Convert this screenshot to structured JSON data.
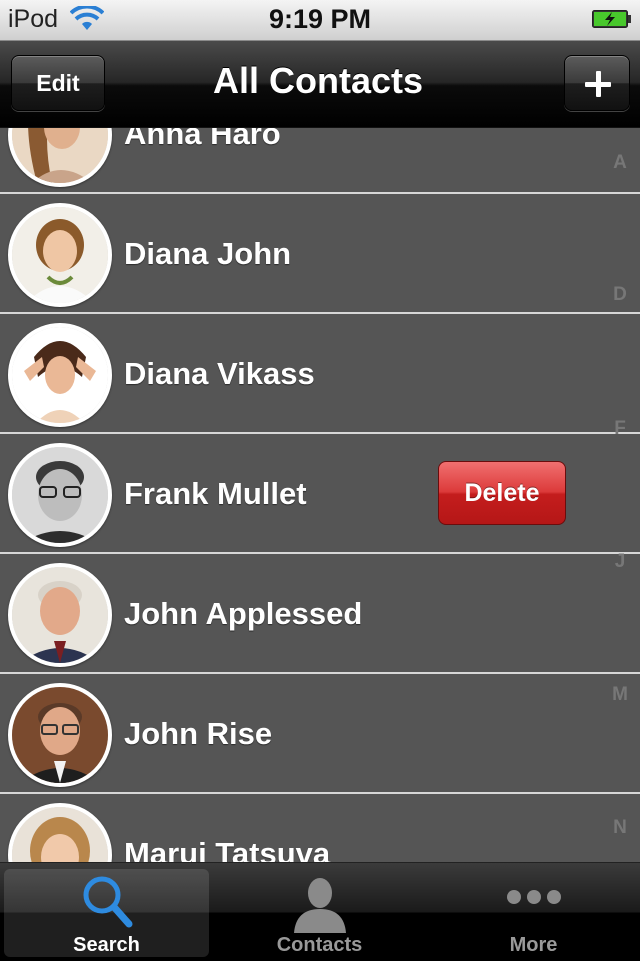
{
  "status_bar": {
    "carrier": "iPod",
    "time": "9:19 PM"
  },
  "nav": {
    "title": "All Contacts",
    "edit_label": "Edit"
  },
  "contacts": [
    {
      "name": "Anna Haro"
    },
    {
      "name": "Diana John"
    },
    {
      "name": "Diana Vikass"
    },
    {
      "name": "Frank Mullet"
    },
    {
      "name": "John Applessed"
    },
    {
      "name": "John Rise"
    },
    {
      "name": "Marui Tatsuva"
    }
  ],
  "delete_label": "Delete",
  "index_letters": [
    "A",
    "D",
    "F",
    "J",
    "M",
    "N"
  ],
  "tabs": [
    {
      "label": "Search",
      "icon": "search-icon",
      "selected": true
    },
    {
      "label": "Contacts",
      "icon": "person-icon",
      "selected": false
    },
    {
      "label": "More",
      "icon": "more-icon",
      "selected": false
    }
  ],
  "colors": {
    "delete": "#c41d1d",
    "search_icon": "#2e8be0",
    "row_bg": "#555555"
  }
}
